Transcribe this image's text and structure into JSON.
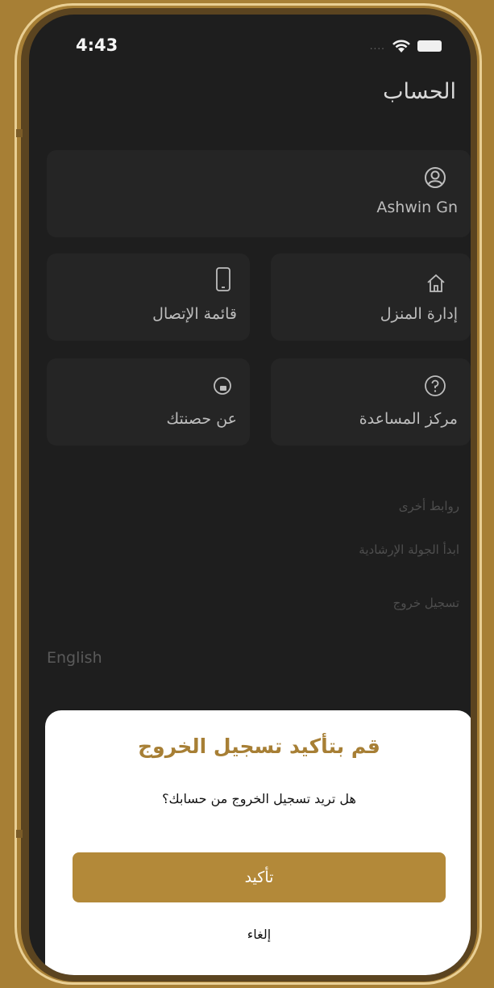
{
  "status_bar": {
    "time": "4:43"
  },
  "header": {
    "title": "الحساب"
  },
  "profile": {
    "name": "Ashwin Gn",
    "icon": "user-circle-icon"
  },
  "tiles": [
    {
      "label": "إدارة المنزل",
      "icon": "home-icon"
    },
    {
      "label": "قائمة الإتصال",
      "icon": "phone-icon"
    },
    {
      "label": "مركز المساعدة",
      "icon": "help-icon"
    },
    {
      "label": "عن حصنتك",
      "icon": "about-icon"
    }
  ],
  "links": {
    "section_title": "روابط أخرى",
    "tour": "ابدأ الجولة الإرشادية",
    "logout": "تسجيل خروج"
  },
  "language": "English",
  "dialog": {
    "title": "قم بتأكيد تسجيل الخروج",
    "message": "هل تريد تسجيل الخروج من حسابك؟",
    "confirm_label": "تأكيد",
    "cancel_label": "إلغاء"
  },
  "colors": {
    "accent": "#b38939",
    "frame": "#a77f35",
    "screen_bg": "#1e1e1e"
  }
}
